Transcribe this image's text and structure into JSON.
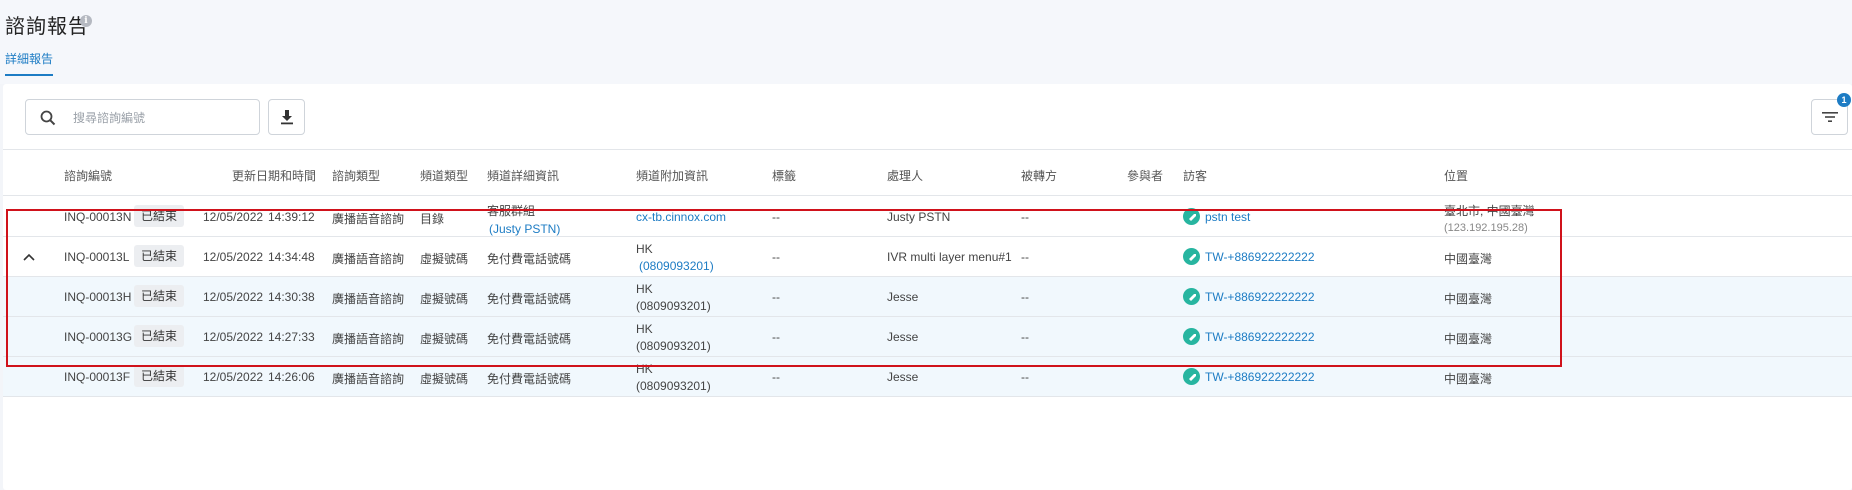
{
  "page": {
    "title": "諮詢報告",
    "info_icon": "info-icon",
    "tab": "詳細報告"
  },
  "toolbar": {
    "search_placeholder": "搜尋諮詢編號",
    "search_icon": "search-icon",
    "download_icon": "download-icon",
    "filter_icon": "filter-icon",
    "filter_badge": "1"
  },
  "columns": [
    "諮詢編號",
    "更新日期和時間",
    "諮詢類型",
    "頻道類型",
    "頻道詳細資訊",
    "頻道附加資訊",
    "標籤",
    "處理人",
    "被轉方",
    "參與者",
    "訪客",
    "位置"
  ],
  "rows": [
    {
      "id": "INQ-00013N",
      "status": "已結束",
      "date": "12/05/2022",
      "time": "14:39:12",
      "type": "廣播語音諮詢",
      "channel_type": "目錄",
      "channel_detail": "客服群組",
      "channel_detail_sub": "(Justy PSTN)",
      "extra": "cx-tb.cinnox.com",
      "extra_sub": "",
      "tag": "--",
      "handler": "Justy PSTN",
      "transferee": "--",
      "visitor": "pstn test",
      "location": "臺北市, 中國臺灣",
      "location_sub": "(123.192.195.28)"
    },
    {
      "id": "INQ-00013L",
      "status": "已結束",
      "date": "12/05/2022",
      "time": "14:34:48",
      "type": "廣播語音諮詢",
      "channel_type": "虛擬號碼",
      "channel_detail": "免付費電話號碼",
      "channel_detail_sub": "",
      "extra": "HK",
      "extra_sub": "(0809093201)",
      "tag": "--",
      "handler": "IVR multi layer menu#1",
      "transferee": "--",
      "visitor": "TW-+886922222222",
      "location": "中國臺灣",
      "location_sub": ""
    },
    {
      "id": "INQ-00013H",
      "status": "已結束",
      "date": "12/05/2022",
      "time": "14:30:38",
      "type": "廣播語音諮詢",
      "channel_type": "虛擬號碼",
      "channel_detail": "免付費電話號碼",
      "channel_detail_sub": "",
      "extra": "HK",
      "extra_sub": "(0809093201)",
      "tag": "--",
      "handler": "Jesse",
      "transferee": "--",
      "visitor": "TW-+886922222222",
      "location": "中國臺灣",
      "location_sub": ""
    },
    {
      "id": "INQ-00013G",
      "status": "已結束",
      "date": "12/05/2022",
      "time": "14:27:33",
      "type": "廣播語音諮詢",
      "channel_type": "虛擬號碼",
      "channel_detail": "免付費電話號碼",
      "channel_detail_sub": "",
      "extra": "HK",
      "extra_sub": "(0809093201)",
      "tag": "--",
      "handler": "Jesse",
      "transferee": "--",
      "visitor": "TW-+886922222222",
      "location": "中國臺灣",
      "location_sub": ""
    },
    {
      "id": "INQ-00013F",
      "status": "已結束",
      "date": "12/05/2022",
      "time": "14:26:06",
      "type": "廣播語音諮詢",
      "channel_type": "虛擬號碼",
      "channel_detail": "免付費電話號碼",
      "channel_detail_sub": "",
      "extra": "HK",
      "extra_sub": "(0809093201)",
      "tag": "--",
      "handler": "Jesse",
      "transferee": "--",
      "visitor": "TW-+886922222222",
      "location": "中國臺灣",
      "location_sub": ""
    }
  ],
  "colors": {
    "accent": "#1d7cc4",
    "visitor_icon": "#27b5a0",
    "highlight_border": "#d0121b",
    "sub_row_bg": "#f1f8fd"
  }
}
